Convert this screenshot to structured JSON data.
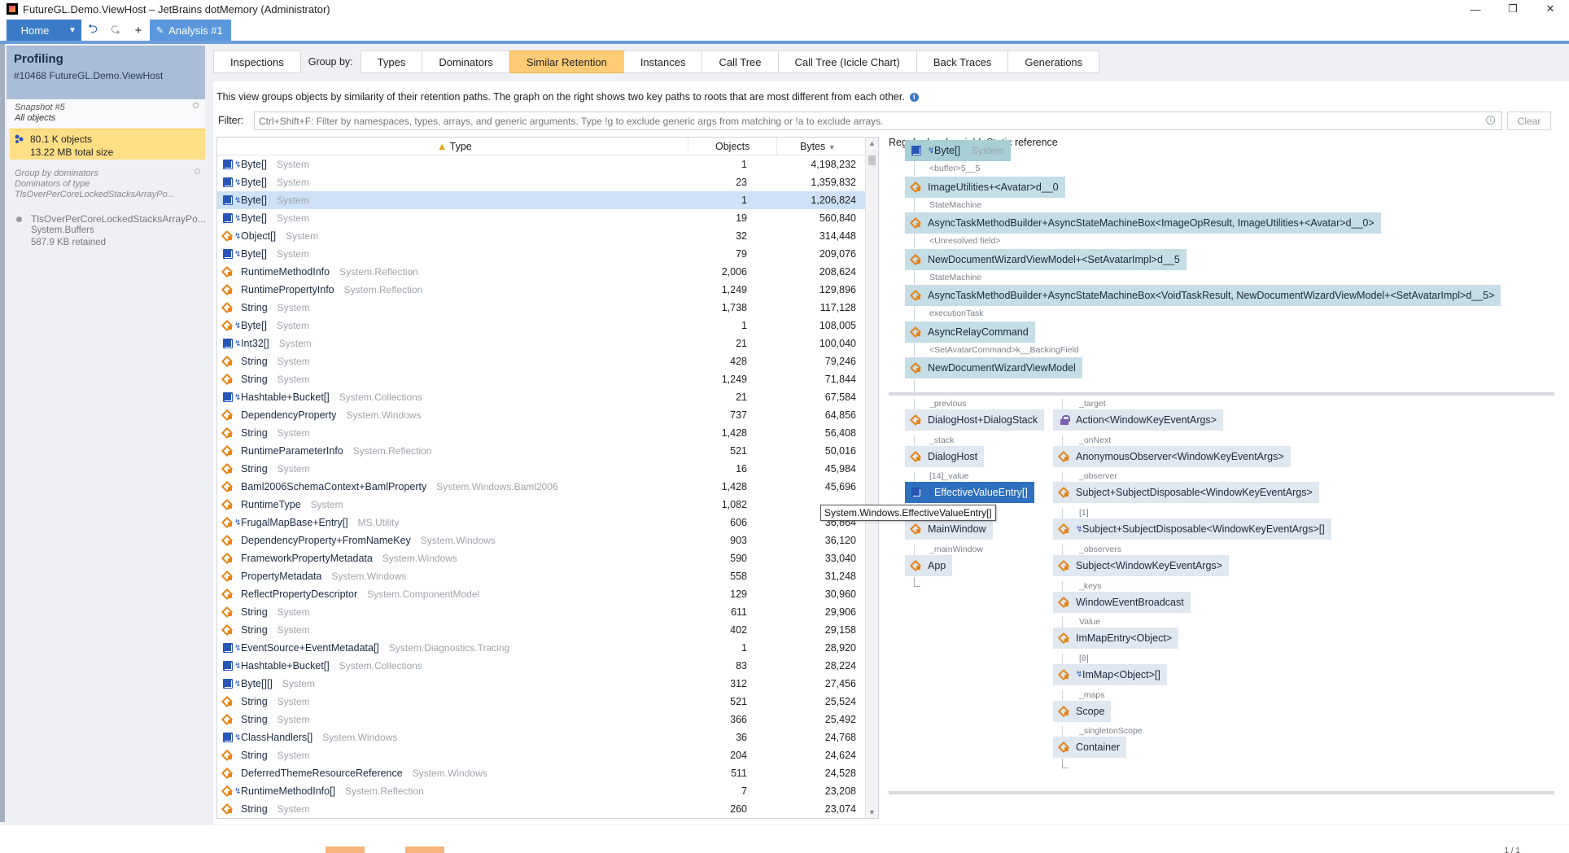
{
  "window": {
    "title": "FutureGL.Demo.ViewHost – JetBrains dotMemory (Administrator)",
    "min": "—",
    "max": "❐",
    "close": "✕"
  },
  "toolbar": {
    "home": "Home",
    "dropdown": "▼",
    "back": "⮌",
    "forward": "⮎",
    "add": "+",
    "analysis_tab": "Analysis #1",
    "analysis_icon": "✎"
  },
  "left": {
    "profiling_title": "Profiling",
    "profiling_sub": "#10468 FutureGL.Demo.ViewHost",
    "snapshot": "Snapshot #5",
    "all_objects": "All objects",
    "objects_count": "80.1 K",
    "objects_label": "objects",
    "size": "13.22 MB",
    "size_label": "total size",
    "group_title": "Group by dominators",
    "group_sub": "Dominators of type",
    "group_type": "TlsOverPerCoreLockedStacksArrayPo...",
    "tls_title": "TlsOverPerCoreLockedStacksArrayPo...",
    "tls_ns": "System.Buffers",
    "tls_retained": "587.9 KB retained"
  },
  "tabs": {
    "inspections": "Inspections",
    "group_by": "Group by:",
    "types": "Types",
    "dominators": "Dominators",
    "similar": "Similar Retention",
    "instances": "Instances",
    "call_tree": "Call Tree",
    "icicle": "Call Tree (Icicle Chart)",
    "back_traces": "Back Traces",
    "generations": "Generations"
  },
  "description": "This view groups objects by similarity of their retention paths. The graph on the right shows two key paths to roots that are most different from each other.",
  "filter": {
    "label": "Filter:",
    "placeholder": "Ctrl+Shift+F: Filter by namespaces, types, arrays, and generic arguments. Type !g to exclude generic args from matching or !a to exclude arrays.",
    "clear": "Clear"
  },
  "table": {
    "col_type": "Type",
    "col_objects": "Objects",
    "col_bytes": "Bytes",
    "rows": [
      {
        "icon": "arr",
        "gen": true,
        "name": "Byte[]",
        "ns": "System",
        "objects": "1",
        "bytes": "4,198,232"
      },
      {
        "icon": "arr",
        "gen": true,
        "name": "Byte[]",
        "ns": "System",
        "objects": "23",
        "bytes": "1,359,832"
      },
      {
        "icon": "arr",
        "gen": true,
        "name": "Byte[]",
        "ns": "System",
        "objects": "1",
        "bytes": "1,206,824",
        "sel": true
      },
      {
        "icon": "arr",
        "gen": true,
        "name": "Byte[]",
        "ns": "System",
        "objects": "19",
        "bytes": "560,840"
      },
      {
        "icon": "cls",
        "gen": true,
        "name": "Object[]",
        "ns": "System",
        "objects": "32",
        "bytes": "314,448"
      },
      {
        "icon": "arr",
        "gen": true,
        "name": "Byte[]",
        "ns": "System",
        "objects": "79",
        "bytes": "209,076"
      },
      {
        "icon": "cls",
        "gen": false,
        "name": "RuntimeMethodInfo",
        "ns": "System.Reflection",
        "objects": "2,006",
        "bytes": "208,624"
      },
      {
        "icon": "cls",
        "gen": false,
        "name": "RuntimePropertyInfo",
        "ns": "System.Reflection",
        "objects": "1,249",
        "bytes": "129,896"
      },
      {
        "icon": "cls",
        "gen": false,
        "name": "String",
        "ns": "System",
        "objects": "1,738",
        "bytes": "117,128"
      },
      {
        "icon": "cls",
        "gen": true,
        "name": "Byte[]",
        "ns": "System",
        "objects": "1",
        "bytes": "108,005"
      },
      {
        "icon": "arr",
        "gen": true,
        "name": "Int32[]",
        "ns": "System",
        "objects": "21",
        "bytes": "100,040"
      },
      {
        "icon": "cls",
        "gen": false,
        "name": "String",
        "ns": "System",
        "objects": "428",
        "bytes": "79,246"
      },
      {
        "icon": "cls",
        "gen": false,
        "name": "String",
        "ns": "System",
        "objects": "1,249",
        "bytes": "71,844"
      },
      {
        "icon": "arr",
        "gen": true,
        "name": "Hashtable+Bucket[]",
        "ns": "System.Collections",
        "objects": "21",
        "bytes": "67,584"
      },
      {
        "icon": "cls",
        "gen": false,
        "name": "DependencyProperty",
        "ns": "System.Windows",
        "objects": "737",
        "bytes": "64,856"
      },
      {
        "icon": "cls",
        "gen": false,
        "name": "String",
        "ns": "System",
        "objects": "1,428",
        "bytes": "56,408"
      },
      {
        "icon": "cls",
        "gen": false,
        "name": "RuntimeParameterInfo",
        "ns": "System.Reflection",
        "objects": "521",
        "bytes": "50,016"
      },
      {
        "icon": "cls",
        "gen": false,
        "name": "String",
        "ns": "System",
        "objects": "16",
        "bytes": "45,984"
      },
      {
        "icon": "cls",
        "gen": false,
        "name": "Baml2006SchemaContext+BamlProperty",
        "ns": "System.Windows.Baml2006",
        "objects": "1,428",
        "bytes": "45,696"
      },
      {
        "icon": "cls",
        "gen": false,
        "name": "RuntimeType",
        "ns": "System",
        "objects": "1,082",
        "bytes": ""
      },
      {
        "icon": "cls",
        "gen": true,
        "name": "FrugalMapBase+Entry[]",
        "ns": "MS.Utility",
        "objects": "606",
        "bytes": "36,864"
      },
      {
        "icon": "cls",
        "gen": false,
        "name": "DependencyProperty+FromNameKey",
        "ns": "System.Windows",
        "objects": "903",
        "bytes": "36,120"
      },
      {
        "icon": "cls",
        "gen": false,
        "name": "FrameworkPropertyMetadata",
        "ns": "System.Windows",
        "objects": "590",
        "bytes": "33,040"
      },
      {
        "icon": "cls",
        "gen": false,
        "name": "PropertyMetadata",
        "ns": "System.Windows",
        "objects": "558",
        "bytes": "31,248"
      },
      {
        "icon": "cls",
        "gen": false,
        "name": "ReflectPropertyDescriptor",
        "ns": "System.ComponentModel",
        "objects": "129",
        "bytes": "30,960"
      },
      {
        "icon": "cls",
        "gen": false,
        "name": "String",
        "ns": "System",
        "objects": "611",
        "bytes": "29,906"
      },
      {
        "icon": "cls",
        "gen": false,
        "name": "String",
        "ns": "System",
        "objects": "402",
        "bytes": "29,158"
      },
      {
        "icon": "arr",
        "gen": true,
        "name": "EventSource+EventMetadata[]",
        "ns": "System.Diagnostics.Tracing",
        "objects": "1",
        "bytes": "28,920"
      },
      {
        "icon": "arr",
        "gen": true,
        "name": "Hashtable+Bucket[]",
        "ns": "System.Collections",
        "objects": "83",
        "bytes": "28,224"
      },
      {
        "icon": "arr",
        "gen": true,
        "name": "Byte[][]",
        "ns": "System",
        "objects": "312",
        "bytes": "27,456"
      },
      {
        "icon": "cls",
        "gen": false,
        "name": "String",
        "ns": "System",
        "objects": "521",
        "bytes": "25,524"
      },
      {
        "icon": "cls",
        "gen": false,
        "name": "String",
        "ns": "System",
        "objects": "366",
        "bytes": "25,492"
      },
      {
        "icon": "arr",
        "gen": true,
        "name": "ClassHandlers[]",
        "ns": "System.Windows",
        "objects": "36",
        "bytes": "24,768"
      },
      {
        "icon": "cls",
        "gen": false,
        "name": "String",
        "ns": "System",
        "objects": "204",
        "bytes": "24,624"
      },
      {
        "icon": "cls",
        "gen": false,
        "name": "DeferredThemeResourceReference",
        "ns": "System.Windows",
        "objects": "511",
        "bytes": "24,528"
      },
      {
        "icon": "cls",
        "gen": true,
        "name": "RuntimeMethodInfo[]",
        "ns": "System.Reflection",
        "objects": "7",
        "bytes": "23,208"
      },
      {
        "icon": "cls",
        "gen": false,
        "name": "String",
        "ns": "System",
        "objects": "260",
        "bytes": "23,074"
      }
    ]
  },
  "graph": {
    "top_nodes": [
      {
        "label": "Byte[]",
        "ns": "System",
        "icon": "arr",
        "edge": "<buffer>5__5"
      },
      {
        "label": "ImageUtilities+<Avatar>d__0",
        "icon": "cls",
        "edge": "StateMachine"
      },
      {
        "label": "AsyncTaskMethodBuilder+AsyncStateMachineBox<ImageOpResult, ImageUtilities+<Avatar>d__0>",
        "icon": "cls",
        "edge": "<Unresolved field>"
      },
      {
        "label": "NewDocumentWizardViewModel+<SetAvatarImpl>d__5",
        "icon": "cls",
        "edge": "StateMachine"
      },
      {
        "label": "AsyncTaskMethodBuilder+AsyncStateMachineBox<VoidTaskResult, NewDocumentWizardViewModel+<SetAvatarImpl>d__5>",
        "icon": "cls",
        "edge": "executionTask"
      },
      {
        "label": "AsyncRelayCommand",
        "icon": "cls",
        "edge": "<SetAvatarCommand>k__BackingField"
      },
      {
        "label": "NewDocumentWizardViewModel",
        "icon": "cls",
        "edge": ""
      }
    ],
    "left_path": [
      {
        "edge": "_previous",
        "label": "DialogHost+DialogStack",
        "icon": "cls"
      },
      {
        "edge": "_stack",
        "label": "DialogHost",
        "icon": "cls"
      },
      {
        "edge": "[14]_value",
        "label": "EffectiveValueEntry[]",
        "icon": "arr",
        "blue": true
      },
      {
        "edge": "",
        "label": "MainWindow",
        "icon": "cls"
      },
      {
        "edge": "_mainWindow",
        "label": "App",
        "icon": "cls"
      }
    ],
    "left_root": "Regular local variable",
    "right_path": [
      {
        "edge": "_target",
        "label": "Action<WindowKeyEventArgs>",
        "icon": "lock"
      },
      {
        "edge": "_onNext",
        "label": "AnonymousObserver<WindowKeyEventArgs>",
        "icon": "cls"
      },
      {
        "edge": "_observer",
        "label": "Subject+SubjectDisposable<WindowKeyEventArgs>",
        "icon": "cls"
      },
      {
        "edge": "[1]",
        "label": "Subject+SubjectDisposable<WindowKeyEventArgs>[]",
        "icon": "cls",
        "gen": true
      },
      {
        "edge": "_observers",
        "label": "Subject<WindowKeyEventArgs>",
        "icon": "cls"
      },
      {
        "edge": "_keys",
        "label": "WindowEventBroadcast",
        "icon": "cls"
      },
      {
        "edge": "Value",
        "label": "ImMapEntry<Object>",
        "icon": "cls"
      },
      {
        "edge": "[8]",
        "label": "ImMap<Object>[]",
        "icon": "cls",
        "gen": true
      },
      {
        "edge": "_maps",
        "label": "Scope",
        "icon": "cls"
      },
      {
        "edge": "_singletonScope",
        "label": "Container",
        "icon": "cls"
      }
    ],
    "right_root": "Static reference",
    "tooltip": "System.Windows.EffectiveValueEntry[]"
  },
  "status": {
    "pager": "1 / 1"
  },
  "colors": {
    "accent": "#3a7bc8",
    "selected_tab": "#ffcc75",
    "selection": "#cfe1f6",
    "node": "#c5dde6"
  }
}
